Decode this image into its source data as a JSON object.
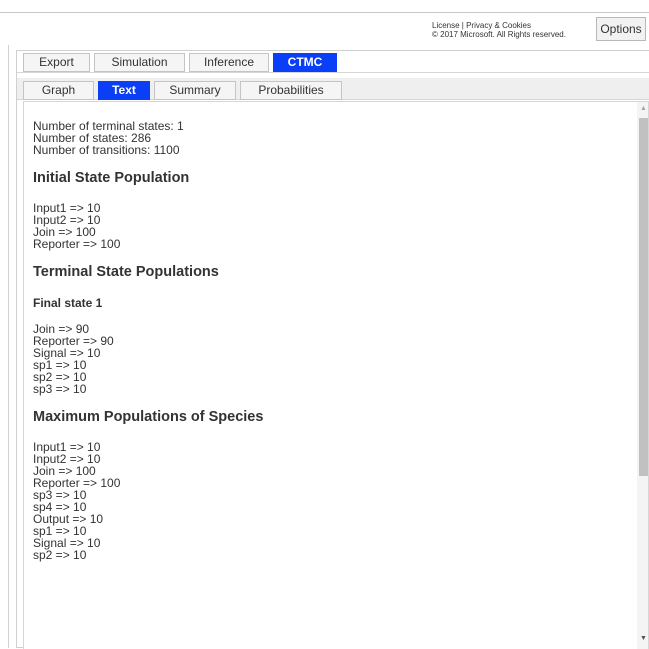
{
  "header": {
    "license_line1": "License | Privacy & Cookies",
    "license_line2": "© 2017 Microsoft. All Rights reserved.",
    "options_label": "Options"
  },
  "main_tabs": [
    {
      "label": "Export",
      "active": false
    },
    {
      "label": "Simulation",
      "active": false
    },
    {
      "label": "Inference",
      "active": false
    },
    {
      "label": "CTMC",
      "active": true
    }
  ],
  "sub_tabs": [
    {
      "label": "Graph",
      "active": false
    },
    {
      "label": "Text",
      "active": true
    },
    {
      "label": "Summary",
      "active": false
    },
    {
      "label": "Probabilities",
      "active": false
    }
  ],
  "content": {
    "stats": [
      "Number of terminal states: 1",
      "Number of states: 286",
      "Number of transitions: 1100"
    ],
    "initial_heading": "Initial State Population",
    "initial": [
      "Input1 => 10",
      "Input2 => 10",
      "Join => 100",
      "Reporter => 100"
    ],
    "terminal_heading": "Terminal State Populations",
    "final_state_heading": "Final state 1",
    "final_state": [
      "Join => 90",
      "Reporter => 90",
      "Signal => 10",
      "sp1 => 10",
      "sp2 => 10",
      "sp3 => 10"
    ],
    "max_heading": "Maximum Populations of Species",
    "max": [
      "Input1 => 10",
      "Input2 => 10",
      "Join => 100",
      "Reporter => 100",
      "sp3 => 10",
      "sp4 => 10",
      "Output => 10",
      "sp1 => 10",
      "Signal => 10",
      "sp2 => 10"
    ]
  },
  "scrollbar": {
    "up_icon": "▲",
    "down_icon": "▼"
  },
  "colors": {
    "active_tab": "#0a3ff7",
    "scroll_thumb": "#c1c1c1"
  }
}
